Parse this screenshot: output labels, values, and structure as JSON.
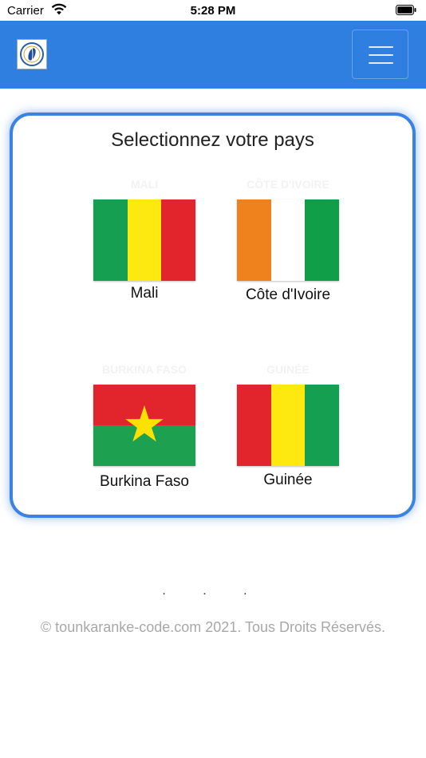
{
  "status_bar": {
    "carrier": "Carrier",
    "time": "5:28 PM"
  },
  "navbar": {
    "background": "#2f7fe0",
    "logo_icon": "brand-logo-icon",
    "menu_icon": "hamburger-menu-icon"
  },
  "card": {
    "title": "Selectionnez votre pays",
    "border_color": "#3a82e4",
    "countries": [
      {
        "name": "Mali",
        "ghost_label": "MALI",
        "flag_colors": [
          "#14a050",
          "#fde910",
          "#e2242c"
        ],
        "flag_icon": "mali-flag-icon"
      },
      {
        "name": "Côte d'Ivoire",
        "ghost_label": "CÔTE D'IVOIRE",
        "flag_colors": [
          "#f0821e",
          "#ffffff",
          "#119e48"
        ],
        "flag_icon": "cote-divoire-flag-icon"
      },
      {
        "name": "Burkina Faso",
        "ghost_label": "BURKINA FASO",
        "flag_colors": [
          "#e2242c",
          "#1da150",
          "#fde100"
        ],
        "flag_icon": "burkina-faso-flag-icon"
      },
      {
        "name": "Guinée",
        "ghost_label": "GUINÉE",
        "flag_colors": [
          "#e2242c",
          "#fde910",
          "#14a050"
        ],
        "flag_icon": "guinee-flag-icon"
      }
    ]
  },
  "pager_dots": ". . .",
  "footer": "© tounkaranke-code.com 2021. Tous Droits Réservés."
}
